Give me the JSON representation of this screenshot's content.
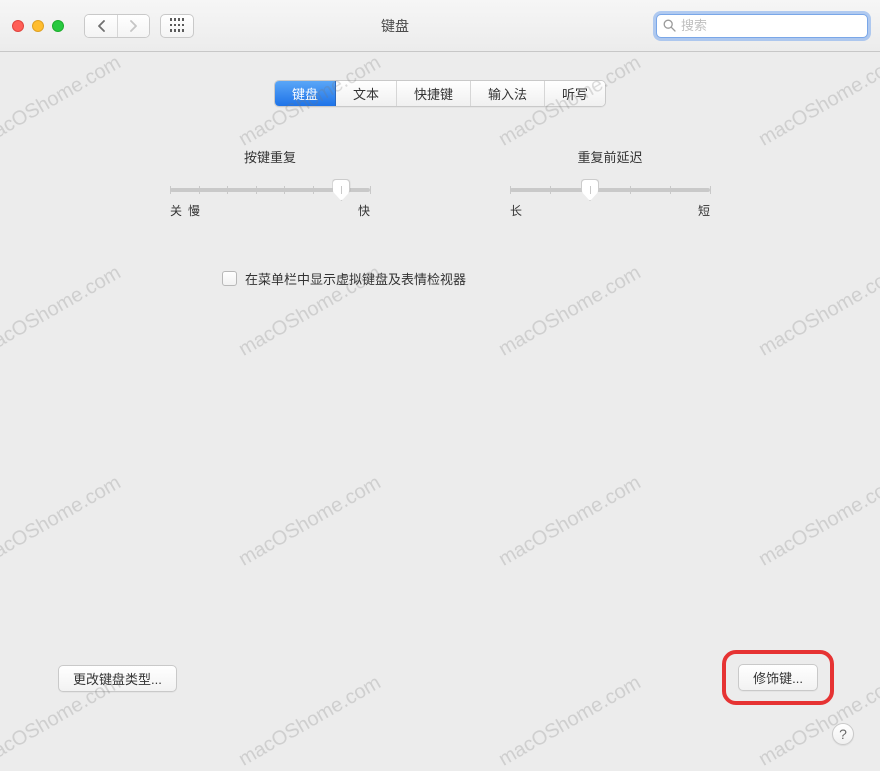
{
  "window": {
    "title": "键盘"
  },
  "search": {
    "placeholder": "搜索"
  },
  "tabs": [
    {
      "label": "键盘",
      "active": true
    },
    {
      "label": "文本",
      "active": false
    },
    {
      "label": "快捷键",
      "active": false
    },
    {
      "label": "输入法",
      "active": false
    },
    {
      "label": "听写",
      "active": false
    }
  ],
  "slider_key_repeat": {
    "title": "按键重复",
    "left_a": "关",
    "left_b": "慢",
    "right": "快",
    "ticks": 8,
    "value_index": 6
  },
  "slider_delay": {
    "title": "重复前延迟",
    "left": "长",
    "right": "短",
    "ticks": 6,
    "value_index": 2
  },
  "checkbox": {
    "label": "在菜单栏中显示虚拟键盘及表情检视器",
    "checked": false
  },
  "buttons": {
    "change_type": "更改键盘类型...",
    "modifier": "修饰键..."
  },
  "watermark": "macOShome.com"
}
